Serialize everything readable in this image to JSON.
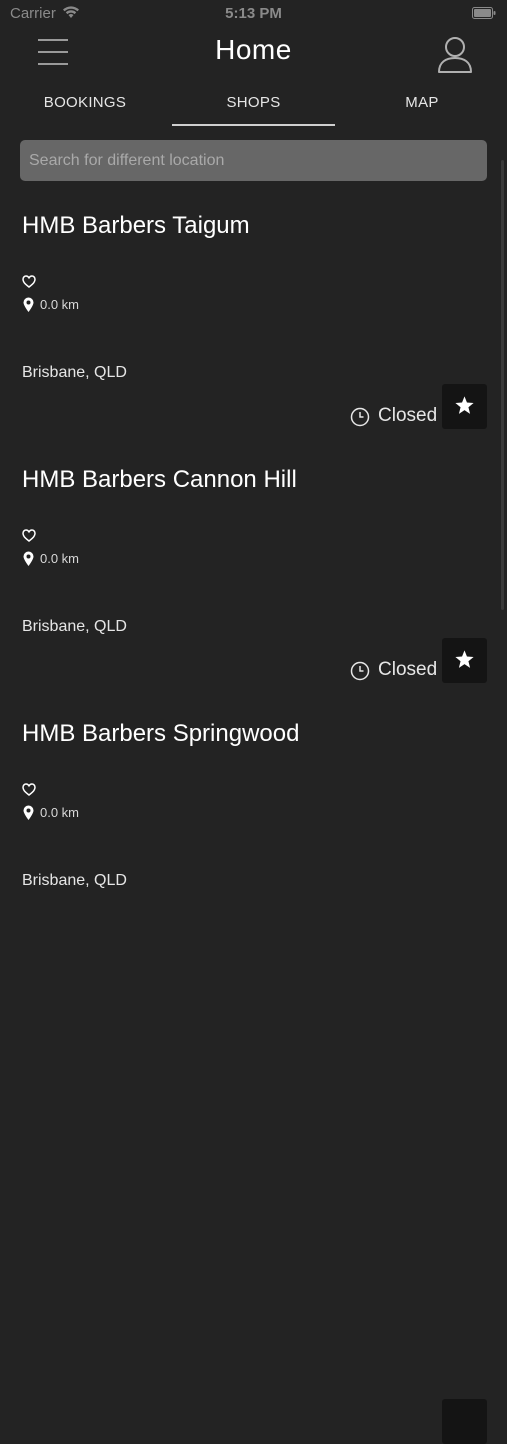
{
  "status_bar": {
    "carrier": "Carrier",
    "time": "5:13 PM",
    "icons": [
      "wifi-icon",
      "battery-icon"
    ]
  },
  "header": {
    "title": "Home",
    "left_icon": "hamburger-menu-icon",
    "right_icon": "user-profile-icon"
  },
  "tabs": [
    {
      "label": "BOOKINGS",
      "selected": false
    },
    {
      "label": "SHOPS",
      "selected": true
    },
    {
      "label": "MAP",
      "selected": false
    }
  ],
  "search": {
    "placeholder": "Search for different location",
    "value": ""
  },
  "shops": [
    {
      "name": "HMB Barbers Taigum",
      "distance": "0.0 km",
      "address": "Brisbane, QLD",
      "status": "Closed"
    },
    {
      "name": "HMB Barbers Cannon Hill",
      "distance": "0.0 km",
      "address": "Brisbane, QLD",
      "status": "Closed"
    },
    {
      "name": "HMB Barbers Springwood",
      "distance": "0.0 km",
      "address": "Brisbane, QLD",
      "status": ""
    }
  ],
  "colors": {
    "background": "#232323",
    "search_field": "#676767",
    "favorite_button": "#141414",
    "text_primary": "#ffffff",
    "text_muted": "#a9a9a9"
  }
}
